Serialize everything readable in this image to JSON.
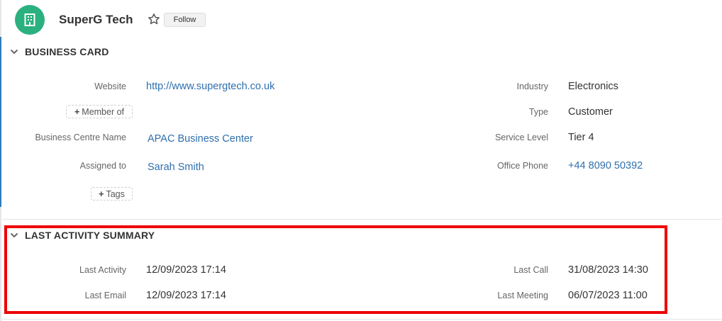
{
  "record": {
    "name": "SuperG Tech",
    "follow_label": "Follow",
    "icon": "building-icon"
  },
  "business_card": {
    "title": "BUSINESS CARD",
    "website_label": "Website",
    "website_value": "http://www.supergtech.co.uk",
    "member_of_label": "Member of",
    "business_centre_label": "Business Centre Name",
    "business_centre_value": "APAC Business Center",
    "assigned_to_label": "Assigned to",
    "assigned_to_value": "Sarah Smith",
    "tags_label": "Tags",
    "industry_label": "Industry",
    "industry_value": "Electronics",
    "type_label": "Type",
    "type_value": "Customer",
    "service_level_label": "Service Level",
    "service_level_value": "Tier 4",
    "office_phone_label": "Office Phone",
    "office_phone_value": "+44 8090 50392"
  },
  "activity": {
    "title": "LAST ACTIVITY SUMMARY",
    "last_activity_label": "Last Activity",
    "last_activity_value": "12/09/2023 17:14",
    "last_email_label": "Last Email",
    "last_email_value": "12/09/2023 17:14",
    "last_call_label": "Last Call",
    "last_call_value": "31/08/2023 14:30",
    "last_meeting_label": "Last Meeting",
    "last_meeting_value": "06/07/2023 11:00"
  },
  "colors": {
    "avatar": "#2bb07f",
    "link": "#2f6fae",
    "highlight": "#ee0000"
  }
}
